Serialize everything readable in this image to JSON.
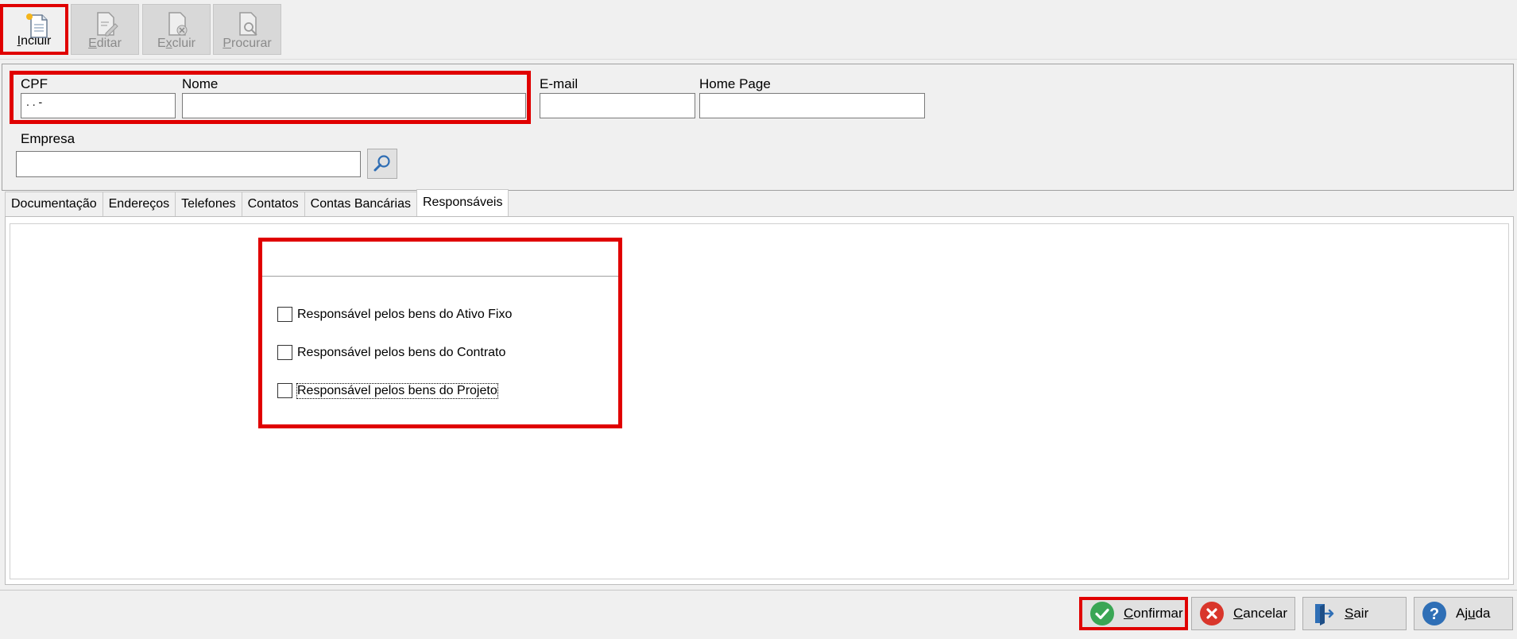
{
  "toolbar": {
    "buttons": [
      {
        "label": "Incluir",
        "accel": "I",
        "rest": "ncluir",
        "icon": "new-document-icon",
        "enabled": true
      },
      {
        "label": "Editar",
        "accel": "E",
        "rest": "ditar",
        "icon": "edit-document-icon",
        "enabled": false
      },
      {
        "label": "Excluir",
        "accel": "x",
        "pre": "E",
        "rest": "cluir",
        "icon": "delete-document-icon",
        "enabled": false
      },
      {
        "label": "Procurar",
        "accel": "P",
        "rest": "rocurar",
        "icon": "search-document-icon",
        "enabled": false
      }
    ]
  },
  "form": {
    "cpf_label": "CPF",
    "cpf_value": " .  .  -",
    "nome_label": "Nome",
    "nome_value": "",
    "email_label": "E-mail",
    "email_value": "",
    "homepage_label": "Home Page",
    "homepage_value": "",
    "empresa_label": "Empresa",
    "empresa_value": ""
  },
  "tabs": [
    {
      "label": "Documentação",
      "active": false
    },
    {
      "label": "Endereços",
      "active": false
    },
    {
      "label": "Telefones",
      "active": false
    },
    {
      "label": "Contatos",
      "active": false
    },
    {
      "label": "Contas Bancárias",
      "active": false
    },
    {
      "label": "Responsáveis",
      "active": true
    }
  ],
  "responsaveis": {
    "group_title": "",
    "options": [
      {
        "label": "Responsável pelos bens do Ativo Fixo",
        "checked": false
      },
      {
        "label": "Responsável pelos bens do Contrato",
        "checked": false
      },
      {
        "label": "Responsável pelos bens do Projeto",
        "checked": false
      }
    ]
  },
  "bottom": {
    "confirmar": {
      "pre": "",
      "accel": "C",
      "rest": "onfirmar",
      "icon": "check-icon",
      "color": "#3aa655"
    },
    "cancelar": {
      "pre": "",
      "accel": "C",
      "rest": "ancelar",
      "icon": "cancel-icon",
      "color": "#d9362b"
    },
    "sair": {
      "pre": "",
      "accel": "S",
      "rest": "air",
      "icon": "exit-icon",
      "color": "#2f6fb6"
    },
    "ajuda": {
      "pre": "Aj",
      "accel": "u",
      "rest": "da",
      "icon": "help-icon",
      "color": "#2f6fb6"
    }
  },
  "colors": {
    "highlight": "#e00000"
  }
}
